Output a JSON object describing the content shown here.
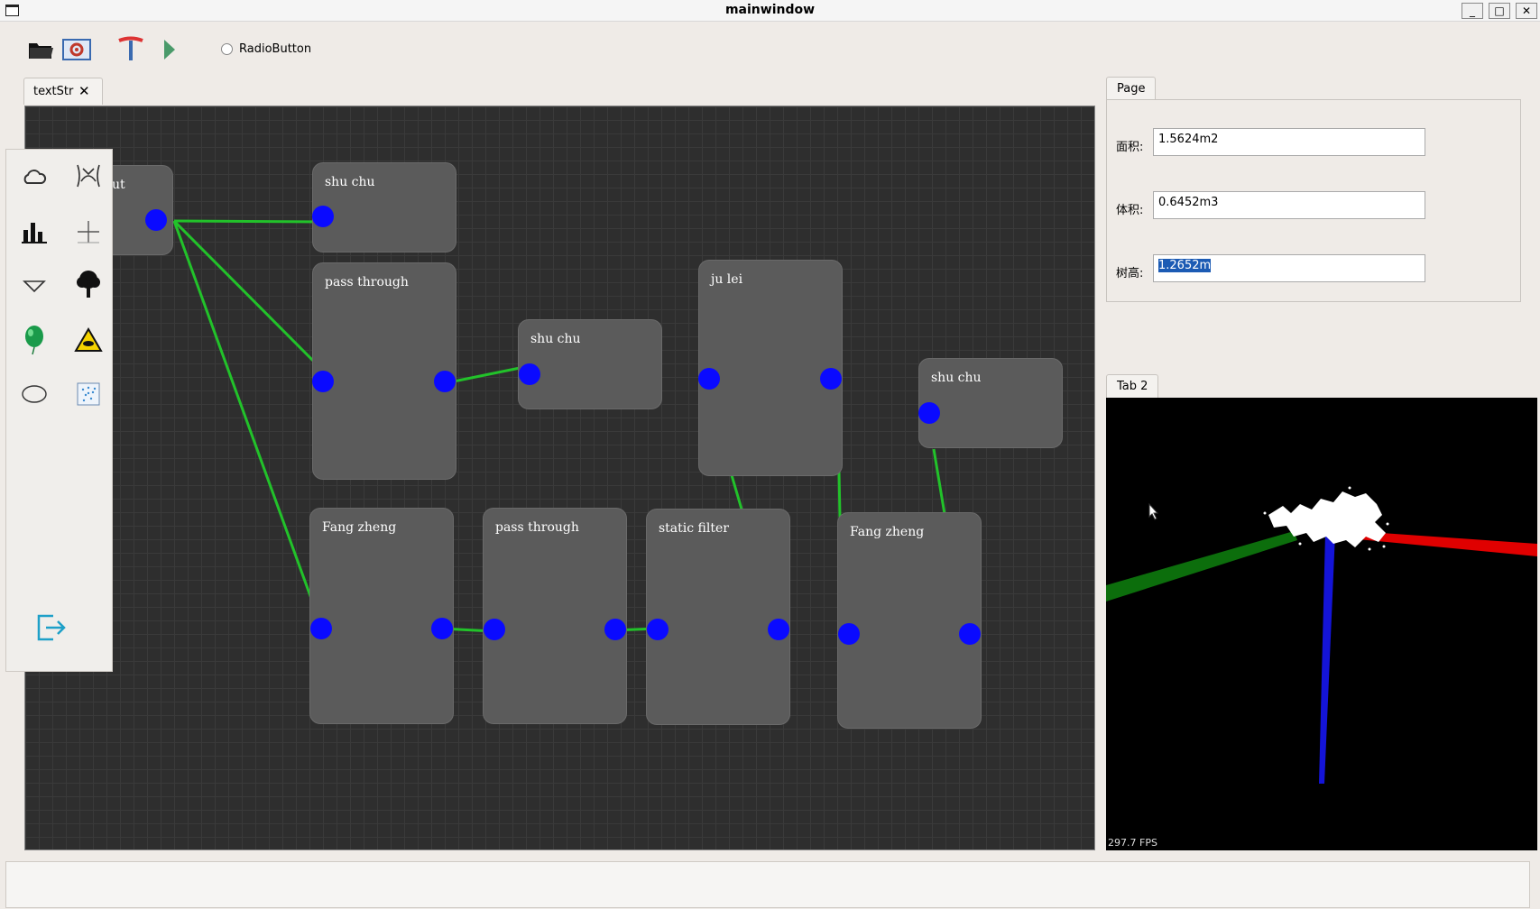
{
  "window": {
    "title": "mainwindow",
    "controls": [
      "_",
      "□",
      "✕"
    ]
  },
  "toolbar": {
    "icons": [
      "open-folder-icon",
      "settings-image-icon",
      "text-tool-icon",
      "run-icon"
    ],
    "radio_label": "RadioButton"
  },
  "editor": {
    "tab_label": "textStr",
    "tab_close": "✕",
    "nodes": [
      {
        "title": "ut"
      },
      {
        "title": "shu chu"
      },
      {
        "title": "pass through"
      },
      {
        "title": "shu chu"
      },
      {
        "title": "ju lei"
      },
      {
        "title": "shu chu"
      },
      {
        "title": "Fang zheng"
      },
      {
        "title": "pass through"
      },
      {
        "title": "static filter"
      },
      {
        "title": "Fang zheng"
      }
    ]
  },
  "palette": {
    "items": [
      "cloud-icon",
      "pelvis-icon",
      "bar-chart-icon",
      "plus-icon",
      "triangle-down-icon",
      "tree-icon",
      "balloon-icon",
      "warning-icon",
      "ellipse-icon",
      "scatter-icon",
      "exit-icon"
    ]
  },
  "page_panel": {
    "tab": "Page",
    "fields": [
      {
        "label": "面积:",
        "value": "1.5624m2"
      },
      {
        "label": "体积:",
        "value": "0.6452m3"
      },
      {
        "label": "树高:",
        "value": "1.2652m"
      }
    ]
  },
  "viewer_panel": {
    "tab": "Tab 2",
    "fps": "297.7 FPS",
    "axis_colors": {
      "x": "#ff0000",
      "y": "#008000",
      "z": "#0000ff"
    }
  }
}
